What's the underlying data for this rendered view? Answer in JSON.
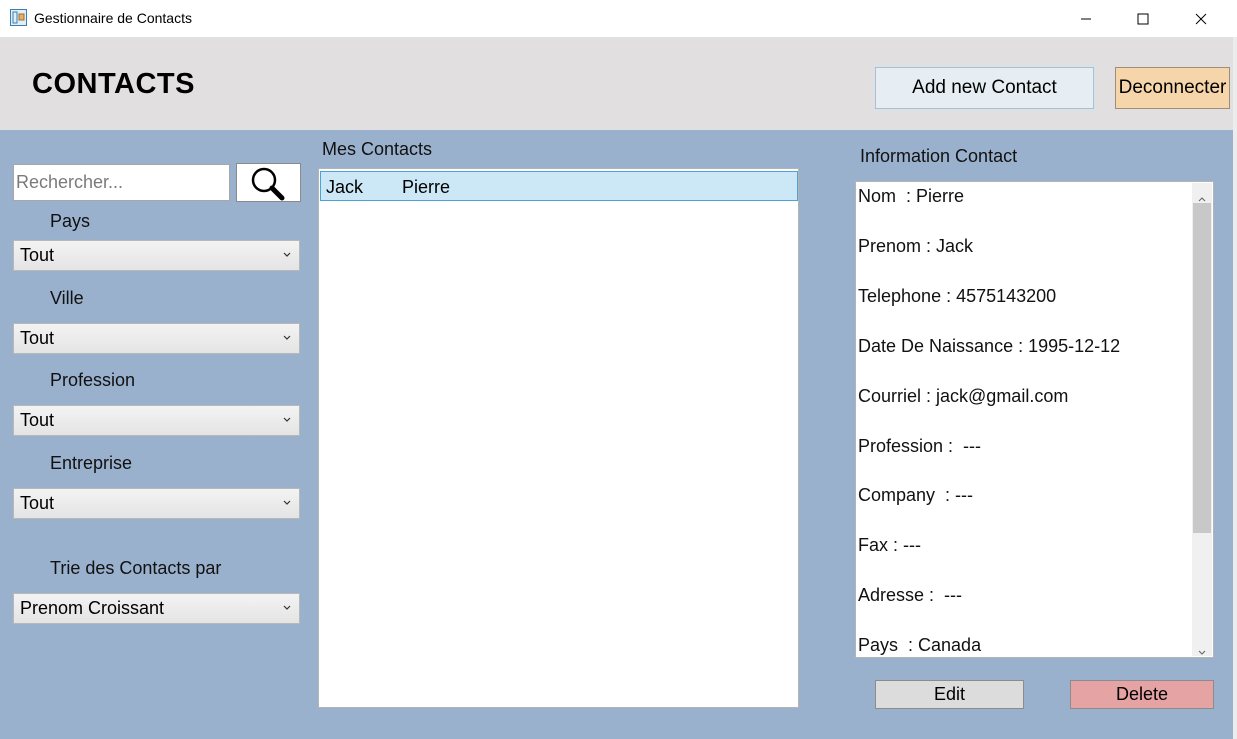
{
  "window": {
    "title": "Gestionnaire de Contacts",
    "controls": [
      "minimize-icon",
      "maximize-icon",
      "close-icon"
    ]
  },
  "header": {
    "title": "CONTACTS",
    "add_contact_label": "Add new Contact",
    "logout_label": "Deconnecter"
  },
  "filters": {
    "search_placeholder": "Rechercher...",
    "search_icon": "magnifier-icon",
    "country_label": "Pays",
    "country_value": "Tout",
    "city_label": "Ville",
    "city_value": "Tout",
    "profession_label": "Profession",
    "profession_value": "Tout",
    "company_label": "Entreprise",
    "company_value": "Tout",
    "sort_label": "Trie des Contacts par",
    "sort_value": "Prenom Croissant"
  },
  "contacts": {
    "heading": "Mes Contacts",
    "rows": [
      {
        "first_name": "Jack",
        "last_name": "Pierre"
      }
    ]
  },
  "info": {
    "heading": "Information Contact",
    "lines": [
      "Nom  : Pierre",
      "Prenom : Jack",
      "Telephone : 4575143200",
      "Date De Naissance : 1995-12-12",
      "Courriel : jack@gmail.com",
      "Profession :  ---",
      "Company  : ---",
      "Fax : ---",
      "Adresse :  ---",
      "Pays  : Canada"
    ],
    "edit_label": "Edit",
    "delete_label": "Delete"
  },
  "colors": {
    "main_background": "#9ab1cd",
    "header_background": "#e1dfdf",
    "logout_button": "#f5d5a9",
    "delete_button": "#e6a3a3",
    "selected_row": "#cce8f6"
  }
}
